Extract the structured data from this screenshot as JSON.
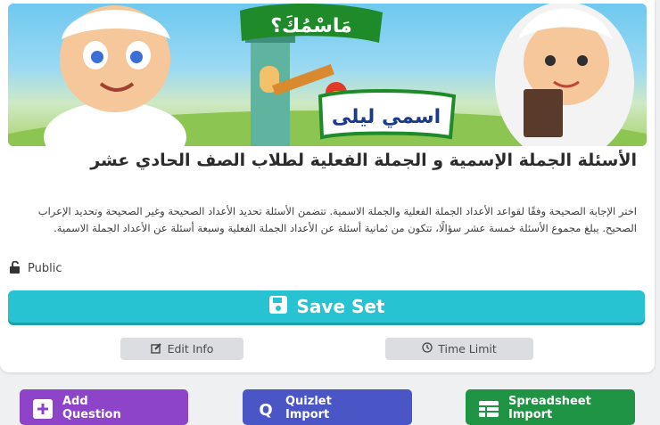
{
  "cover": {
    "sign_top": "مَاسْمُكَ؟",
    "sign_bottom": "اسمي ليلى"
  },
  "set": {
    "title": "الأسئلة الجملة الإسمية و الجملة الفعلية لطلاب الصف الحادي عشر",
    "description": "اختر الإجابة الصحيحة وفقًا لقواعد الأعداد الجملة الفعلية والجملة الاسمية. تتضمن الأسئلة تحديد الأعداد الصحيحة وغير الصحيحة وتحديد الإعراب الصحيح. يبلغ مجموع الأسئلة خمسة عشر سؤالًا، تتكون من ثمانية أسئلة عن الأعداد الجملة الفعلية وسبعة أسئلة عن الأعداد الجملة الاسمية.",
    "visibility": "Public"
  },
  "actions": {
    "save_label": "Save Set",
    "edit_info_label": "Edit Info",
    "time_limit_label": "Time Limit"
  },
  "imports": {
    "add_line1": "Add",
    "add_line2": "Question",
    "quizlet_line1": "Quizlet",
    "quizlet_line2": "Import",
    "sheet_line1": "Spreadsheet",
    "sheet_line2": "Import"
  },
  "colors": {
    "accent": "#27c3d2",
    "add": "#8e44c9",
    "quizlet": "#4a55c6",
    "spreadsheet": "#1e9444"
  },
  "icons": {
    "visibility": "unlock-icon",
    "save": "floppy-icon",
    "edit": "edit-icon",
    "time": "clock-icon",
    "add": "plus-icon",
    "quizlet": "quizlet-q-icon",
    "sheet": "table-icon"
  }
}
